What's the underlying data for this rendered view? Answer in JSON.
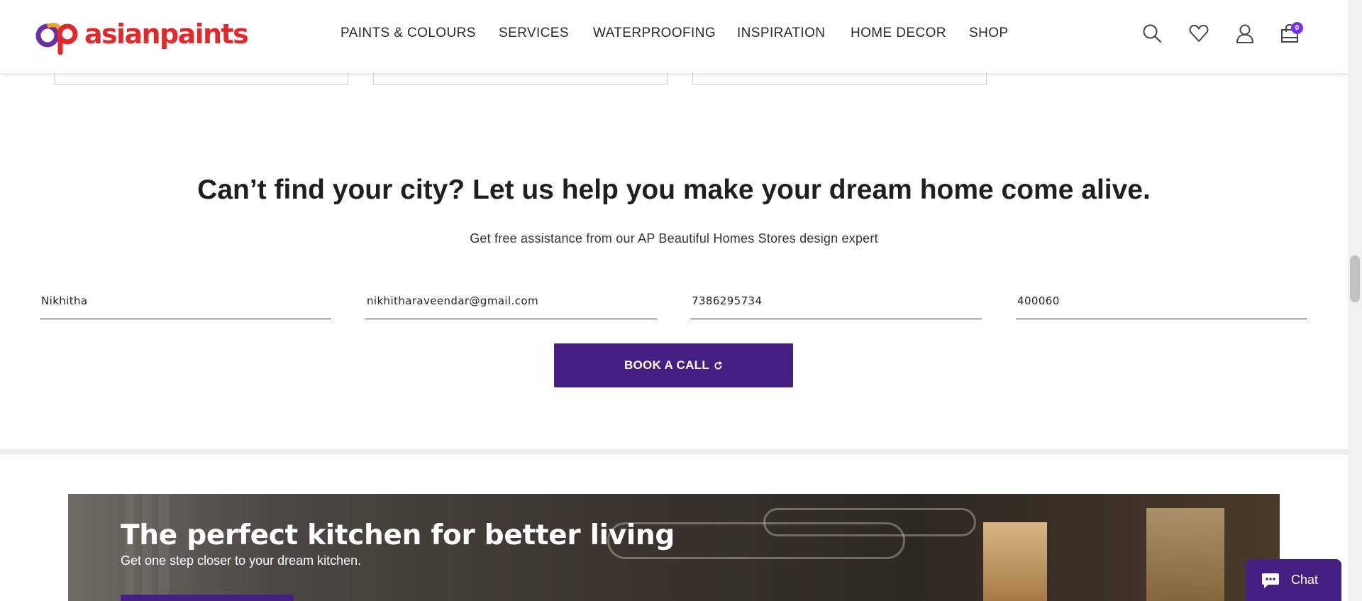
{
  "brand": {
    "name": "asianpaints",
    "color": "#e2282b",
    "accent": "#451f82",
    "badge_color": "#7b2ff2"
  },
  "nav": {
    "items": [
      "PAINTS & COLOURS",
      "SERVICES",
      "WATERPROOFING",
      "INSPIRATION",
      "HOME DECOR",
      "SHOP"
    ]
  },
  "header_icons": {
    "search": "search-icon",
    "wishlist": "heart-icon",
    "account": "user-icon",
    "cart": "cart-icon",
    "cart_count": "0"
  },
  "lead_form": {
    "headline": "Can’t find your city? Let us help you make your dream home come alive.",
    "subline": "Get free assistance from our AP Beautiful Homes Stores design expert",
    "name_value": "Nikhitha",
    "email_value": "nikhitharaveendar@gmail.com",
    "phone_value": "7386295734",
    "pincode_value": "400060",
    "submit_label": "BOOK A CALL",
    "submit_icon": "refresh-icon"
  },
  "banner": {
    "title": "The perfect kitchen for better living",
    "subtitle": "Get one step closer to your dream kitchen."
  },
  "chat": {
    "label": "Chat",
    "icon": "chat-bubble-icon"
  }
}
